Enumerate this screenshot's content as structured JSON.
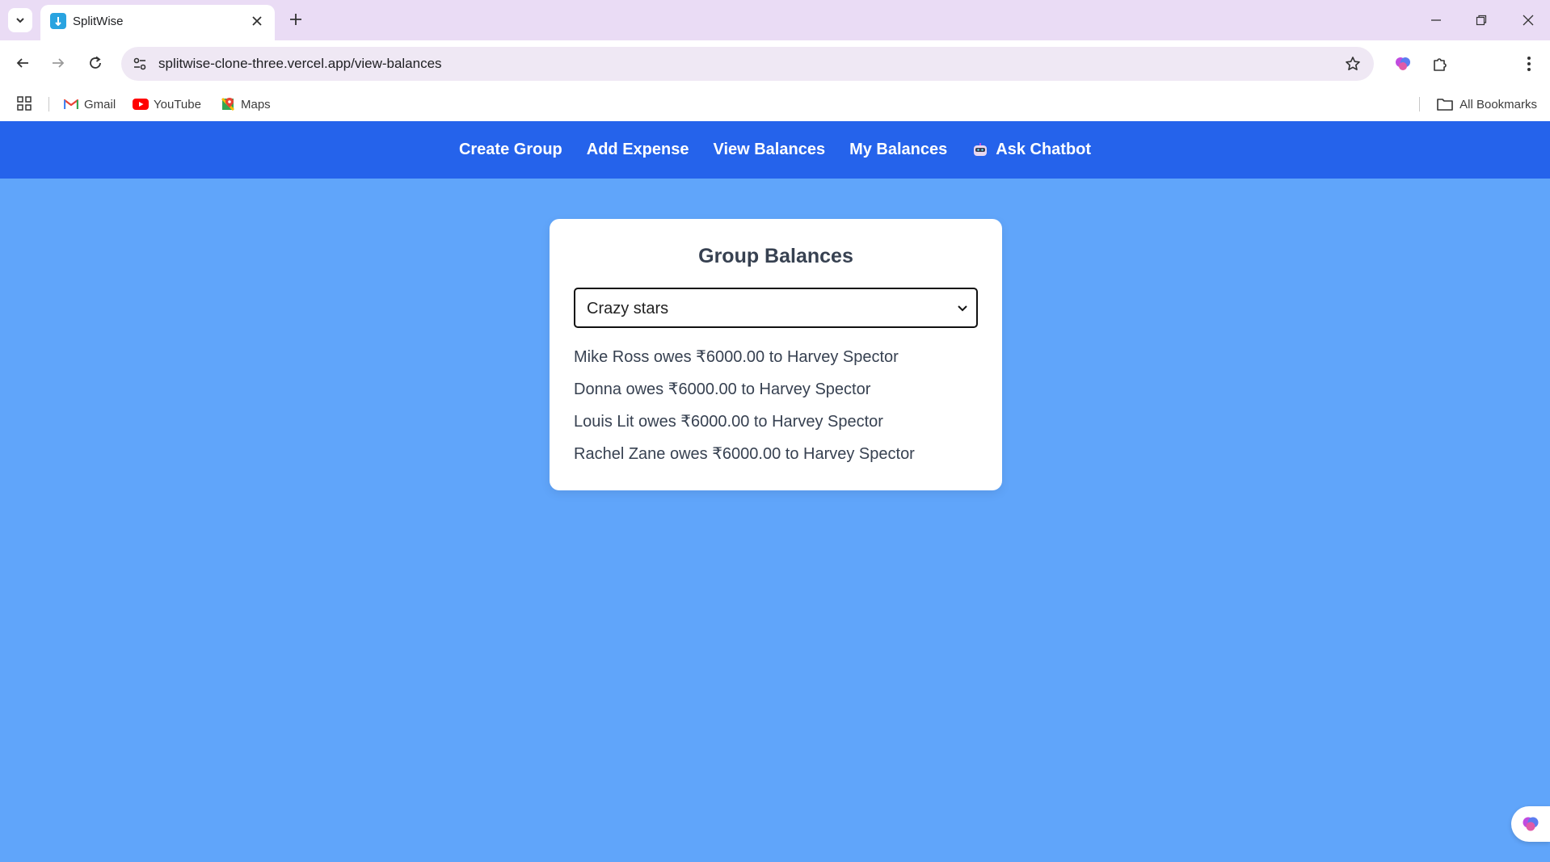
{
  "browser": {
    "tab_title": "SplitWise",
    "url": "splitwise-clone-three.vercel.app/view-balances",
    "bookmarks": [
      {
        "label": "Gmail",
        "icon": "gmail-icon"
      },
      {
        "label": "YouTube",
        "icon": "youtube-icon"
      },
      {
        "label": "Maps",
        "icon": "maps-icon"
      }
    ],
    "all_bookmarks_label": "All Bookmarks"
  },
  "nav": {
    "links": [
      "Create Group",
      "Add Expense",
      "View Balances",
      "My Balances"
    ],
    "chatbot_label": "Ask Chatbot"
  },
  "balances": {
    "title": "Group Balances",
    "selected_group": "Crazy stars",
    "items": [
      "Mike Ross owes ₹6000.00 to Harvey Spector",
      "Donna owes ₹6000.00 to Harvey Spector",
      "Louis Lit owes ₹6000.00 to Harvey Spector",
      "Rachel Zane owes ₹6000.00 to Harvey Spector"
    ]
  },
  "colors": {
    "nav_bg": "#2563eb",
    "page_bg": "#60a5fa",
    "card_bg": "#ffffff"
  }
}
